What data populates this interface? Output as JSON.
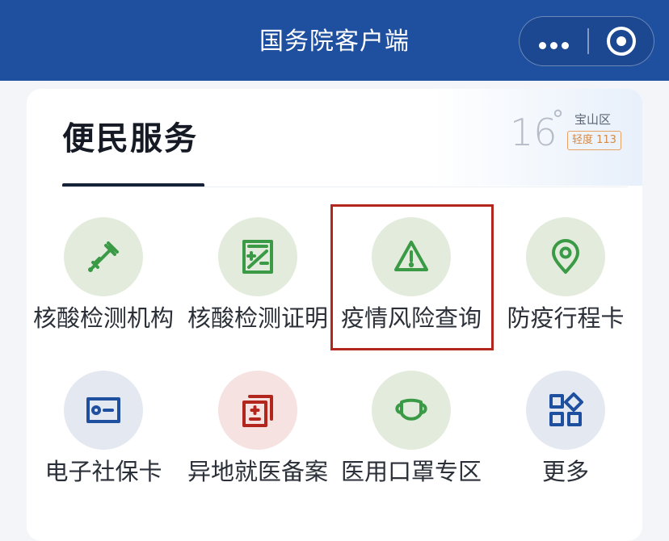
{
  "titlebar": {
    "title": "国务院客户端"
  },
  "card": {
    "title": "便民服务"
  },
  "weather": {
    "temperature": "16",
    "degree": "°",
    "district": "宝山区",
    "aqi": "轻度 113"
  },
  "services": [
    {
      "label": "核酸检测机构",
      "icon": "dropper-icon",
      "color": "#3a9a45"
    },
    {
      "label": "核酸检测证明",
      "icon": "certificate-icon",
      "color": "#3a9a45"
    },
    {
      "label": "疫情风险查询",
      "icon": "warning-icon",
      "color": "#3a9a45"
    },
    {
      "label": "防疫行程卡",
      "icon": "location-pin-icon",
      "color": "#3a9a45"
    },
    {
      "label": "电子社保卡",
      "icon": "id-card-icon",
      "color": "#1f4f9f"
    },
    {
      "label": "异地就医备案",
      "icon": "medical-record-icon",
      "color": "#b3261e"
    },
    {
      "label": "医用口罩专区",
      "icon": "mask-icon",
      "color": "#3a9a45"
    },
    {
      "label": "更多",
      "icon": "grid-apps-icon",
      "color": "#1f4f9f"
    }
  ]
}
